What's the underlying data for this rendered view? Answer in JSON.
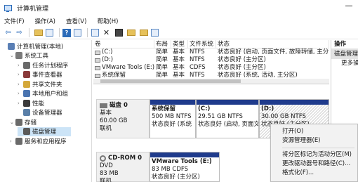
{
  "window": {
    "title": "计算机管理"
  },
  "menu": [
    "文件(F)",
    "操作(A)",
    "查看(V)",
    "帮助(H)"
  ],
  "toolbar": [
    {
      "icon": "back-arrow-icon",
      "glyph": "⇦"
    },
    {
      "icon": "forward-arrow-icon",
      "glyph": "⇨"
    },
    {
      "icon": "up-folder-icon",
      "glyph": ""
    },
    {
      "icon": "show-hide-tree-icon",
      "glyph": ""
    },
    {
      "icon": "help-icon",
      "glyph": "?"
    },
    {
      "icon": "properties-icon",
      "glyph": ""
    },
    {
      "icon": "refresh-icon",
      "glyph": ""
    },
    {
      "icon": "delete-icon",
      "glyph": "✕"
    },
    {
      "icon": "properties-sheet-icon",
      "glyph": ""
    },
    {
      "icon": "open-folder-icon",
      "glyph": ""
    },
    {
      "icon": "search-folder-icon",
      "glyph": ""
    },
    {
      "icon": "tool-icon",
      "glyph": ""
    }
  ],
  "tree": [
    {
      "label": "计算机管理(本地)",
      "icon": "computer-management-icon",
      "color": "#5a7fb5",
      "indent": 0,
      "chev": ""
    },
    {
      "label": "系统工具",
      "icon": "tools-icon",
      "color": "#7a7a7a",
      "indent": 1,
      "chev": "⌄"
    },
    {
      "label": "任务计划程序",
      "icon": "clock-icon",
      "color": "#6a6a6a",
      "indent": 2,
      "chev": "›"
    },
    {
      "label": "事件查看器",
      "icon": "event-viewer-icon",
      "color": "#8a3a3a",
      "indent": 2,
      "chev": "›"
    },
    {
      "label": "共享文件夹",
      "icon": "shared-folder-icon",
      "color": "#d4a83a",
      "indent": 2,
      "chev": "›"
    },
    {
      "label": "本地用户和组",
      "icon": "users-icon",
      "color": "#4a74b0",
      "indent": 2,
      "chev": "›"
    },
    {
      "label": "性能",
      "icon": "performance-icon",
      "color": "#3a3a3a",
      "indent": 2,
      "chev": "›"
    },
    {
      "label": "设备管理器",
      "icon": "device-manager-icon",
      "color": "#5a7fa8",
      "indent": 2,
      "chev": ""
    },
    {
      "label": "存储",
      "icon": "storage-icon",
      "color": "#6a6a6a",
      "indent": 1,
      "chev": "⌄"
    },
    {
      "label": "磁盘管理",
      "icon": "disk-management-icon",
      "color": "#5a5a5a",
      "indent": 2,
      "chev": "",
      "selected": true
    },
    {
      "label": "服务和应用程序",
      "icon": "services-icon",
      "color": "#6a6a6a",
      "indent": 1,
      "chev": "›"
    }
  ],
  "volume_list": {
    "headers": [
      "卷",
      "布局",
      "类型",
      "文件系统",
      "状态"
    ],
    "rows": [
      [
        "(C:)",
        "简单",
        "基本",
        "NTFS",
        "状态良好 (启动, 页面文件, 故障转储, 主分"
      ],
      [
        "(D:)",
        "简单",
        "基本",
        "NTFS",
        "状态良好 (主分区)"
      ],
      [
        "VMware Tools (E:)",
        "简单",
        "基本",
        "CDFS",
        "状态良好 (主分区)"
      ],
      [
        "系统保留",
        "简单",
        "基本",
        "NTFS",
        "状态良好 (系统, 活动, 主分区)"
      ]
    ]
  },
  "disks": [
    {
      "name": "磁盘 0",
      "type": "基本",
      "size": "60.00 GB",
      "status": "联机"
    },
    {
      "name": "CD-ROM 0",
      "type": "DVD",
      "size": "83 MB",
      "status": "联机"
    }
  ],
  "partitions": [
    {
      "name": "系统保留",
      "size": "500 MB NTFS",
      "status": "状态良好 (系统"
    },
    {
      "name": "(C:)",
      "size": "29.51 GB NTFS",
      "status": "状态良好 (启动, 页面文件"
    },
    {
      "name": "(D:)",
      "size": "30.00 GB NTFS",
      "status": "状态良好 (主分区)"
    },
    {
      "name": "VMware Tools  (E:)",
      "size": "83 MB CDFS",
      "status": "状态良好 (主分区)"
    }
  ],
  "actions": {
    "title": "操作",
    "selected": "磁盘管理",
    "more": "更多操作"
  },
  "context_menu": [
    "打开(O)",
    "资源管理器(E)",
    "将分区标记为活动分区(M)",
    "更改驱动器号和路径(C)...",
    "格式化(F)..."
  ]
}
